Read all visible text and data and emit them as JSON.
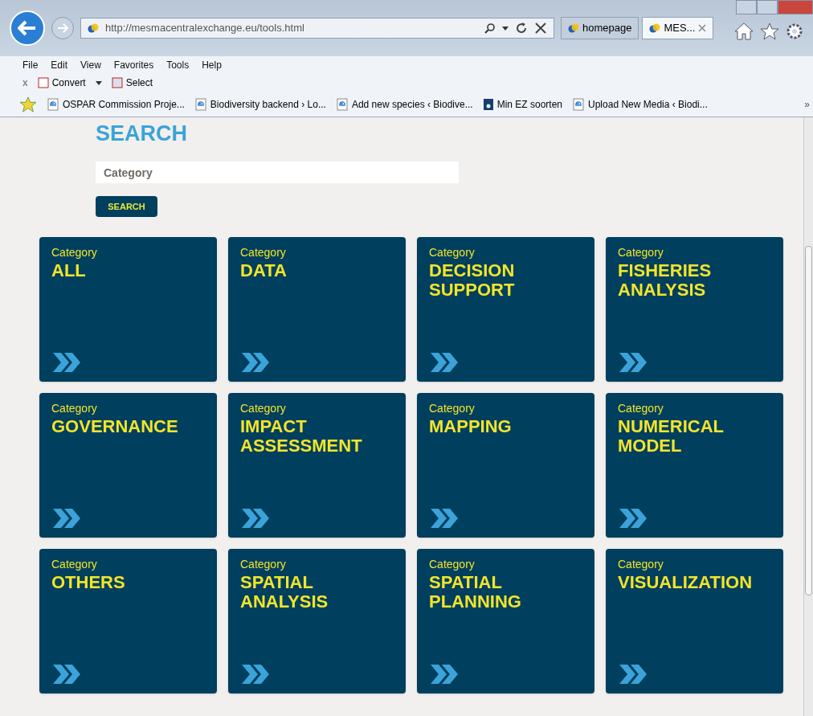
{
  "browser": {
    "url": "http://mesmacentralexchange.eu/tools.html",
    "tabs": [
      {
        "label": "homepage",
        "selected": false
      },
      {
        "label": "MES...",
        "selected": true
      }
    ],
    "menu": [
      "File",
      "Edit",
      "View",
      "Favorites",
      "Tools",
      "Help"
    ],
    "toolbar": {
      "close": "x",
      "convert": "Convert",
      "select": "Select"
    },
    "favorites": [
      {
        "label": "OSPAR Commission Proje...",
        "kind": "ie"
      },
      {
        "label": "Biodiversity backend › Lo...",
        "kind": "ie"
      },
      {
        "label": "Add new species ‹ Biodive...",
        "kind": "ie"
      },
      {
        "label": "Min EZ soorten",
        "kind": "site"
      },
      {
        "label": "Upload New Media ‹ Biodi...",
        "kind": "ie"
      }
    ],
    "more": "»"
  },
  "page": {
    "heading": "SEARCH",
    "search": {
      "placeholder": "Category"
    },
    "button": "SEARCH",
    "tiles": [
      {
        "caption": "Category",
        "title": [
          "ALL"
        ]
      },
      {
        "caption": "Category",
        "title": [
          "DATA"
        ]
      },
      {
        "caption": "Category",
        "title": [
          "DECISION",
          "SUPPORT"
        ]
      },
      {
        "caption": "Category",
        "title": [
          "FISHERIES",
          "ANALYSIS"
        ]
      },
      {
        "caption": "Category",
        "title": [
          "GOVERNANCE"
        ]
      },
      {
        "caption": "Category",
        "title": [
          "IMPACT",
          "ASSESSMENT"
        ]
      },
      {
        "caption": "Category",
        "title": [
          "MAPPING"
        ]
      },
      {
        "caption": "Category",
        "title": [
          "NUMERICAL",
          "MODEL"
        ]
      },
      {
        "caption": "Category",
        "title": [
          "OTHERS"
        ]
      },
      {
        "caption": "Category",
        "title": [
          "SPATIAL",
          "ANALYSIS"
        ]
      },
      {
        "caption": "Category",
        "title": [
          "SPATIAL",
          "PLANNING"
        ]
      },
      {
        "caption": "Category",
        "title": [
          "VISUALIZATION"
        ]
      }
    ]
  }
}
